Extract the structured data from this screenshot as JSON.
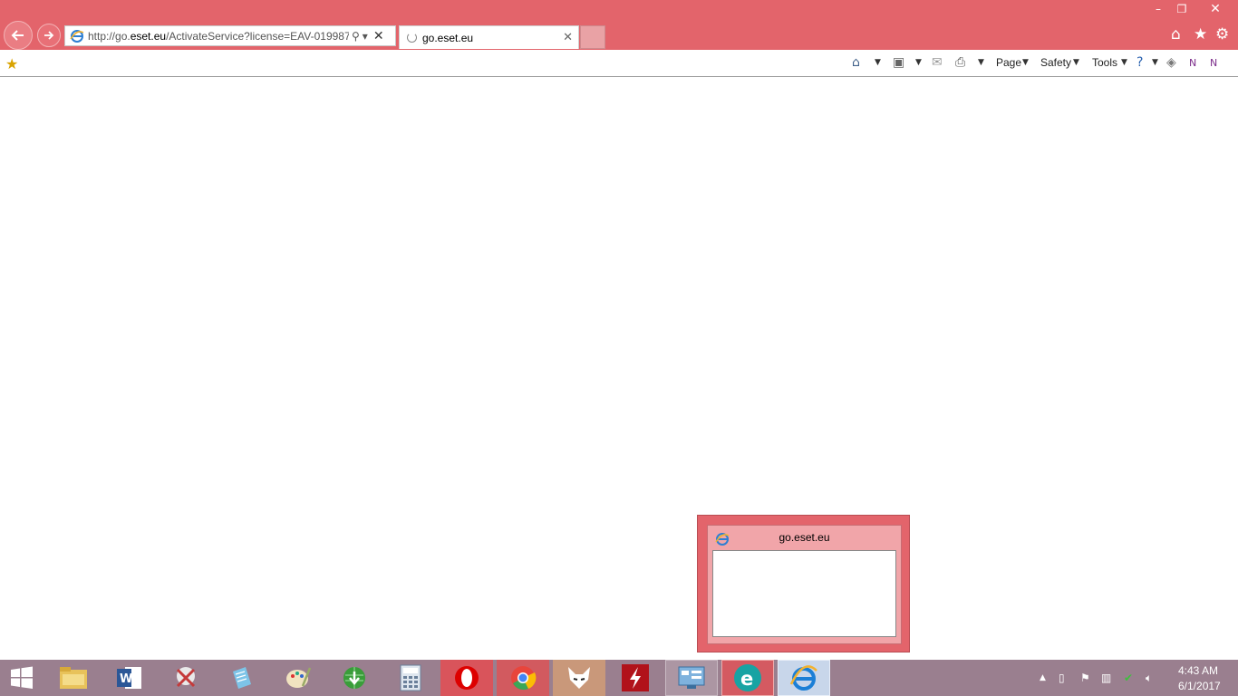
{
  "window": {
    "minimize_glyph": "–",
    "restore_glyph": "❐",
    "close_glyph": "✕"
  },
  "address_bar": {
    "url_prefix": "http://go.",
    "url_domain": "eset.eu",
    "url_suffix": "/ActivateService?license=EAV-019987",
    "search_glyph": "⚲",
    "dropdown_glyph": "▾",
    "stop_glyph": "✕"
  },
  "tab": {
    "title": "go.eset.eu",
    "close_glyph": "✕"
  },
  "commands": {
    "page": "Page",
    "safety": "Safety",
    "tools": "Tools"
  },
  "preview": {
    "title": "go.eset.eu"
  },
  "clock": {
    "time": "4:43 AM",
    "date": "6/1/2017"
  },
  "colors": {
    "chrome": "#e3646b",
    "taskbar": "#9a7f8f"
  },
  "taskbar_apps": [
    "start",
    "file-explorer",
    "word",
    "snipping-tool",
    "notepad",
    "paint",
    "internet-download-manager",
    "calculator",
    "opera",
    "chrome",
    "falkon",
    "flash",
    "control-panel",
    "eset",
    "internet-explorer"
  ]
}
